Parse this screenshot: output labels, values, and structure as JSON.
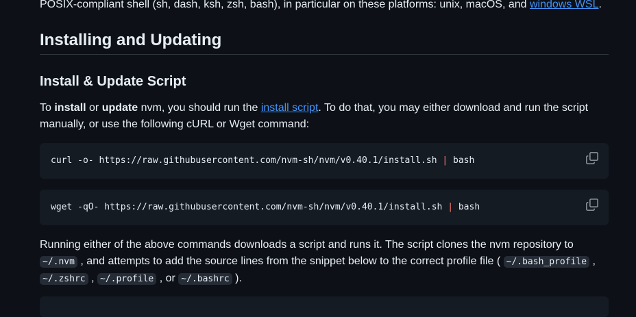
{
  "intro": {
    "text_before_link": "POSIX-compliant shell (sh, dash, ksh, zsh, bash), in particular on these platforms: unix, macOS, and ",
    "link": "windows WSL",
    "text_after_link": "."
  },
  "heading": "Installing and Updating",
  "subheading": "Install & Update Script",
  "para1": {
    "t1": "To ",
    "b1": "install",
    "t2": " or ",
    "b2": "update",
    "t3": " nvm, you should run the ",
    "link": "install script",
    "t4": ". To do that, you may either download and run the script manually, or use the following cURL or Wget command:"
  },
  "code_blocks": [
    {
      "cmd": "curl -o- https://raw.githubusercontent.com/nvm-sh/nvm/v0.40.1/install.sh ",
      "pipe": "|",
      "tail": " bash"
    },
    {
      "cmd": "wget -qO- https://raw.githubusercontent.com/nvm-sh/nvm/v0.40.1/install.sh ",
      "pipe": "|",
      "tail": " bash"
    }
  ],
  "para2": {
    "t1": "Running either of the above commands downloads a script and runs it. The script clones the nvm repository to ",
    "c1": "~/.nvm",
    "t2": " , and attempts to add the source lines from the snippet below to the correct profile file ( ",
    "c2": "~/.bash_profile",
    "t3": " , ",
    "c3": "~/.zshrc",
    "t4": " , ",
    "c4": "~/.profile",
    "t5": " , or ",
    "c5": "~/.bashrc",
    "t6": " )."
  },
  "icons": {
    "copy": "copy-icon"
  },
  "colors": {
    "background": "#0d1117",
    "link": "#4493f8",
    "code_bg": "#151b23",
    "pipe": "#ff7b72"
  }
}
